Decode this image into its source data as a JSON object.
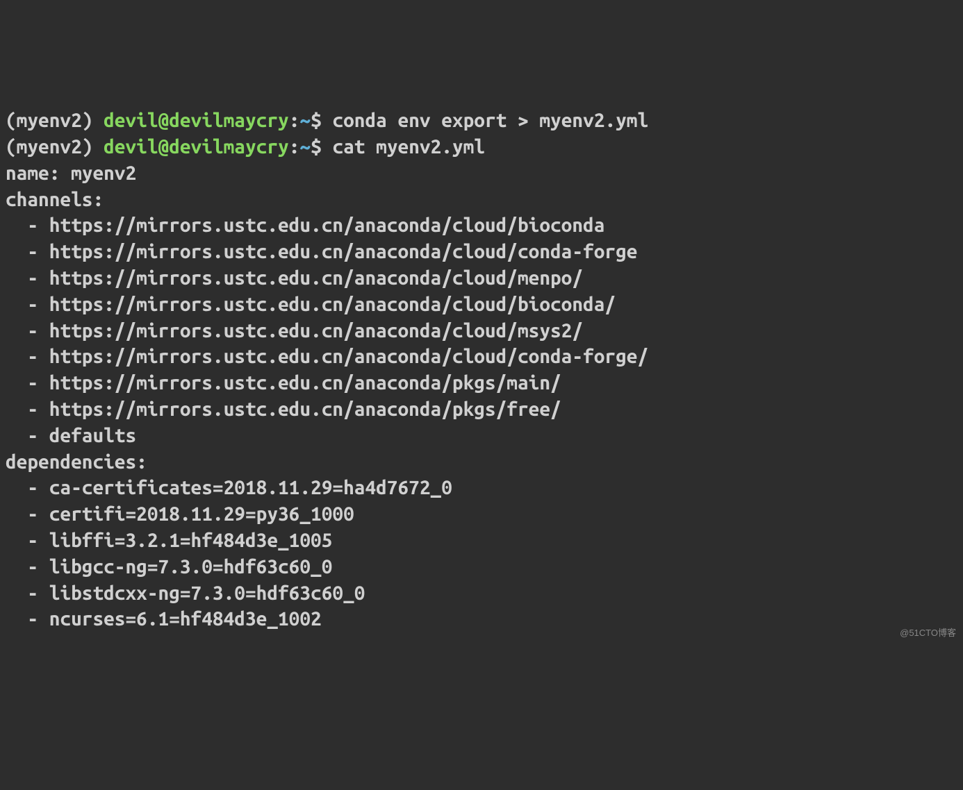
{
  "lines": [
    {
      "type": "prompt",
      "env": "(myenv2) ",
      "userhost": "devil@devilmaycry",
      "colon": ":",
      "path": "~",
      "dollar": "$ ",
      "command": "conda env export > myenv2.yml"
    },
    {
      "type": "prompt",
      "env": "(myenv2) ",
      "userhost": "devil@devilmaycry",
      "colon": ":",
      "path": "~",
      "dollar": "$ ",
      "command": "cat myenv2.yml"
    },
    {
      "type": "output",
      "text": "name: myenv2"
    },
    {
      "type": "output",
      "text": "channels:"
    },
    {
      "type": "output",
      "text": "  - https://mirrors.ustc.edu.cn/anaconda/cloud/bioconda"
    },
    {
      "type": "output",
      "text": "  - https://mirrors.ustc.edu.cn/anaconda/cloud/conda-forge"
    },
    {
      "type": "output",
      "text": "  - https://mirrors.ustc.edu.cn/anaconda/cloud/menpo/"
    },
    {
      "type": "output",
      "text": "  - https://mirrors.ustc.edu.cn/anaconda/cloud/bioconda/"
    },
    {
      "type": "output",
      "text": "  - https://mirrors.ustc.edu.cn/anaconda/cloud/msys2/"
    },
    {
      "type": "output",
      "text": "  - https://mirrors.ustc.edu.cn/anaconda/cloud/conda-forge/"
    },
    {
      "type": "output",
      "text": "  - https://mirrors.ustc.edu.cn/anaconda/pkgs/main/"
    },
    {
      "type": "output",
      "text": "  - https://mirrors.ustc.edu.cn/anaconda/pkgs/free/"
    },
    {
      "type": "output",
      "text": "  - defaults"
    },
    {
      "type": "output",
      "text": "dependencies:"
    },
    {
      "type": "output",
      "text": "  - ca-certificates=2018.11.29=ha4d7672_0"
    },
    {
      "type": "output",
      "text": "  - certifi=2018.11.29=py36_1000"
    },
    {
      "type": "output",
      "text": "  - libffi=3.2.1=hf484d3e_1005"
    },
    {
      "type": "output",
      "text": "  - libgcc-ng=7.3.0=hdf63c60_0"
    },
    {
      "type": "output",
      "text": "  - libstdcxx-ng=7.3.0=hdf63c60_0"
    },
    {
      "type": "output",
      "text": "  - ncurses=6.1=hf484d3e_1002"
    }
  ],
  "watermark": "@51CTO博客"
}
